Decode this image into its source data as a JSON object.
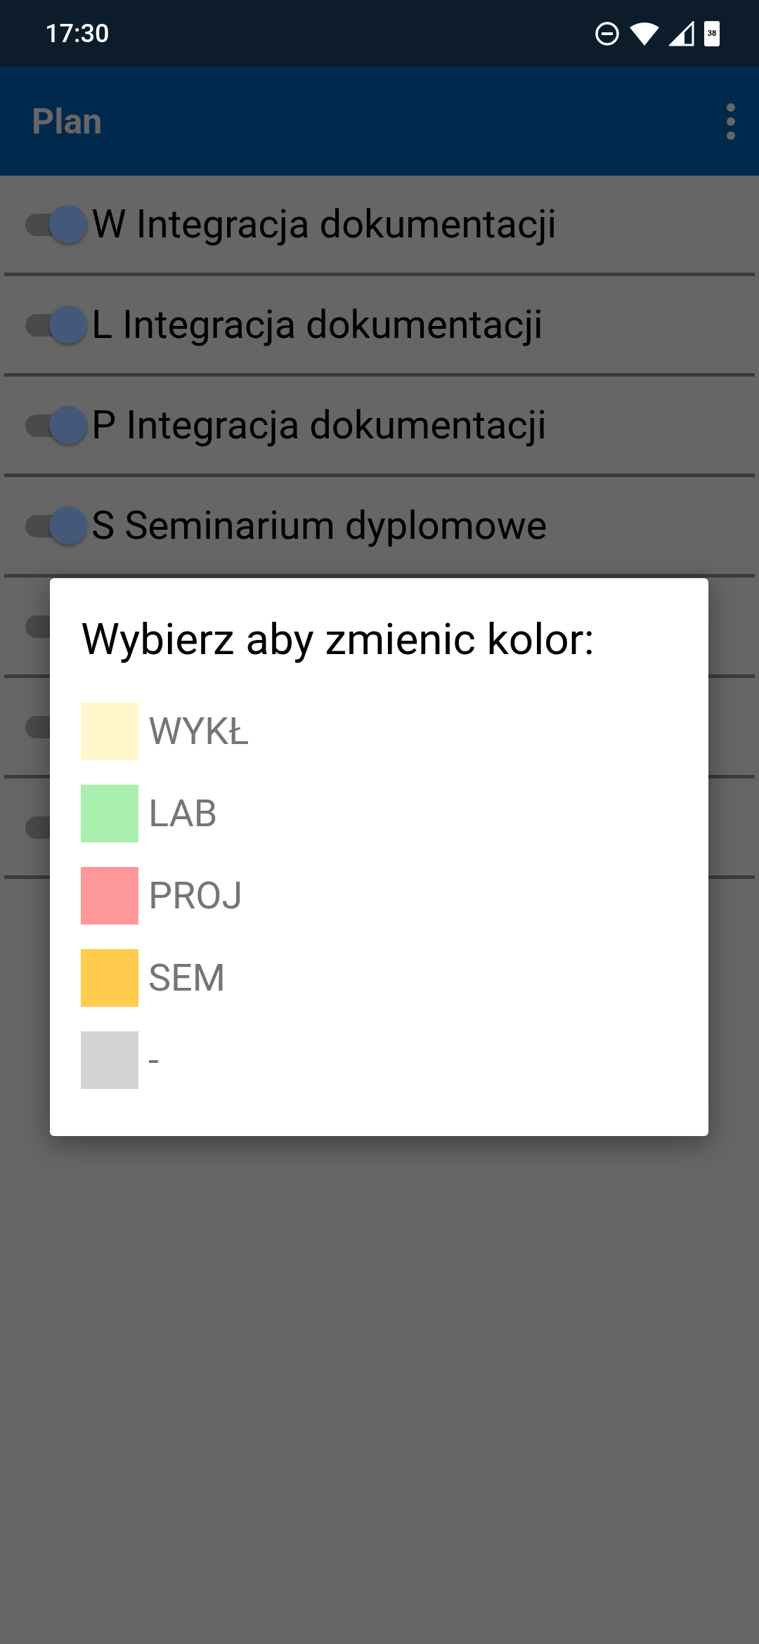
{
  "status_bar": {
    "time": "17:30",
    "battery": "38"
  },
  "app_bar": {
    "title": "Plan"
  },
  "items": [
    {
      "label": "W Integracja dokumentacji",
      "on": true
    },
    {
      "label": "L Integracja dokumentacji",
      "on": true
    },
    {
      "label": "P Integracja dokumentacji",
      "on": true
    },
    {
      "label": "S Seminarium dyplomowe",
      "on": true
    },
    {
      "on": true
    },
    {
      "on": true
    },
    {
      "on": true
    }
  ],
  "dialog": {
    "title": "Wybierz aby zmienic kolor:",
    "options": [
      {
        "label": "WYKŁ",
        "color": "#fff8cc"
      },
      {
        "label": "LAB",
        "color": "#aaefae"
      },
      {
        "label": "PROJ",
        "color": "#ff9999"
      },
      {
        "label": "SEM",
        "color": "#ffcc4d"
      },
      {
        "label": "-",
        "color": "#d3d3d3"
      }
    ]
  }
}
